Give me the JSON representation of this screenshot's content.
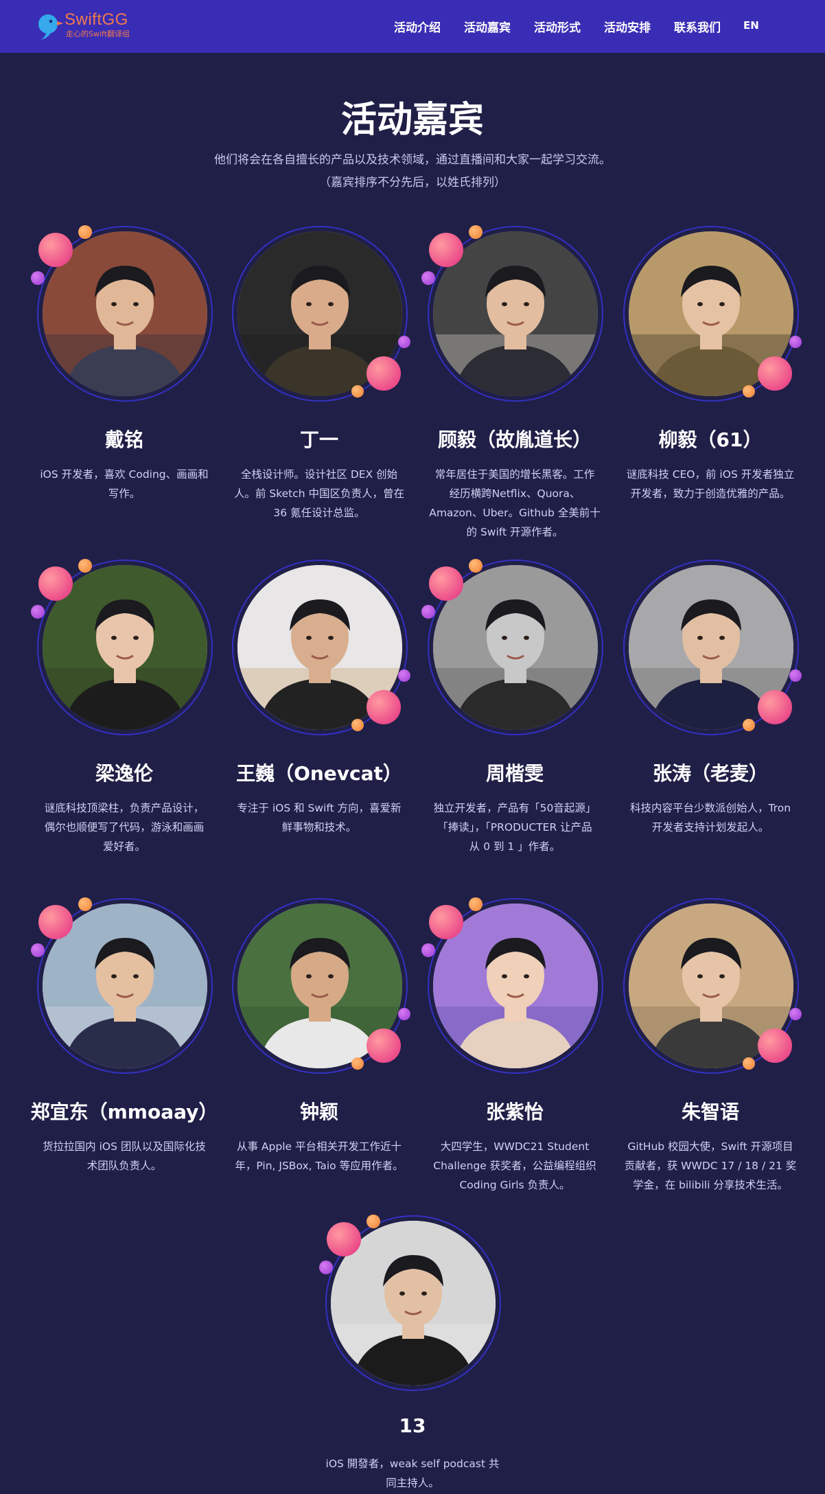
{
  "header": {
    "logo_name": "SwiftGG",
    "logo_sub": "走心的Swift翻译组",
    "nav": [
      "活动介绍",
      "活动嘉宾",
      "活动形式",
      "活动安排",
      "联系我们"
    ],
    "lang": "EN"
  },
  "section": {
    "title": "活动嘉宾",
    "subtitle_1": "他们将会在各自擅长的产品以及技术领域，通过直播间和大家一起学习交流。",
    "subtitle_2": "（嘉宾排序不分先后，以姓氏排列）"
  },
  "colors": {
    "header_bg": "#3a2db5",
    "page_bg": "#201f47",
    "ring": "#3430c4",
    "accent_pink": "#ec4d8a",
    "accent_orange": "#f08032",
    "accent_purple": "#9a3bd4",
    "logo": "#f07a4d"
  },
  "speakers": [
    {
      "name": "戴铭",
      "bio": [
        "iOS 开发者，喜欢 Coding、画画和",
        "写作。"
      ]
    },
    {
      "name": "丁一",
      "bio": [
        "全栈设计师。设计社区 DEX 创始",
        "人。前 Sketch 中国区负责人，曾在",
        "36 氪任设计总监。"
      ]
    },
    {
      "name": "顾毅（故胤道长）",
      "bio": [
        "常年居住于美国的增长黑客。工作",
        "经历横跨Netflix、Quora、",
        "Amazon、Uber。Github 全美前十",
        "的 Swift 开源作者。"
      ]
    },
    {
      "name": "柳毅（61）",
      "bio": [
        "谜底科技 CEO，前 iOS 开发者独立",
        "开发者，致力于创造优雅的产品。"
      ]
    },
    {
      "name": "梁逸伦",
      "bio": [
        "谜底科技顶梁柱，负责产品设计，",
        "偶尔也顺便写了代码，游泳和画画",
        "爱好者。"
      ]
    },
    {
      "name": "王巍（Onevcat）",
      "bio": [
        "专注于 iOS 和 Swift 方向，喜爱新",
        "鲜事物和技术。"
      ]
    },
    {
      "name": "周楷雯",
      "bio": [
        "独立开发者，产品有「50音起源」",
        "「捧读」，「PRODUCTER 让产品",
        "从 0 到 1 」作者。"
      ]
    },
    {
      "name": "张涛（老麦）",
      "bio": [
        "科技内容平台少数派创始人，Tron",
        "开发者支持计划发起人。"
      ]
    },
    {
      "name": "郑宜东（mmoaay）",
      "bio": [
        "货拉拉国内 iOS 团队以及国际化技",
        "术团队负责人。"
      ]
    },
    {
      "name": "钟颖",
      "bio": [
        "从事 Apple 平台相关开发工作近十",
        "年，Pin, JSBox, Taio 等应用作者。"
      ]
    },
    {
      "name": "张紫怡",
      "bio": [
        "大四学生，WWDC21 Student",
        "Challenge 获奖者，公益编程组织",
        "Coding Girls 负责人。"
      ]
    },
    {
      "name": "朱智语",
      "bio": [
        "GitHub 校园大使，Swift 开源项目",
        "贡献者，获 WWDC 17 / 18 / 21 奖",
        "学金，在 bilibili 分享技术生活。"
      ]
    },
    {
      "name": "13",
      "bio": [
        "iOS 開發者，weak self podcast 共",
        "同主持人。"
      ]
    }
  ]
}
